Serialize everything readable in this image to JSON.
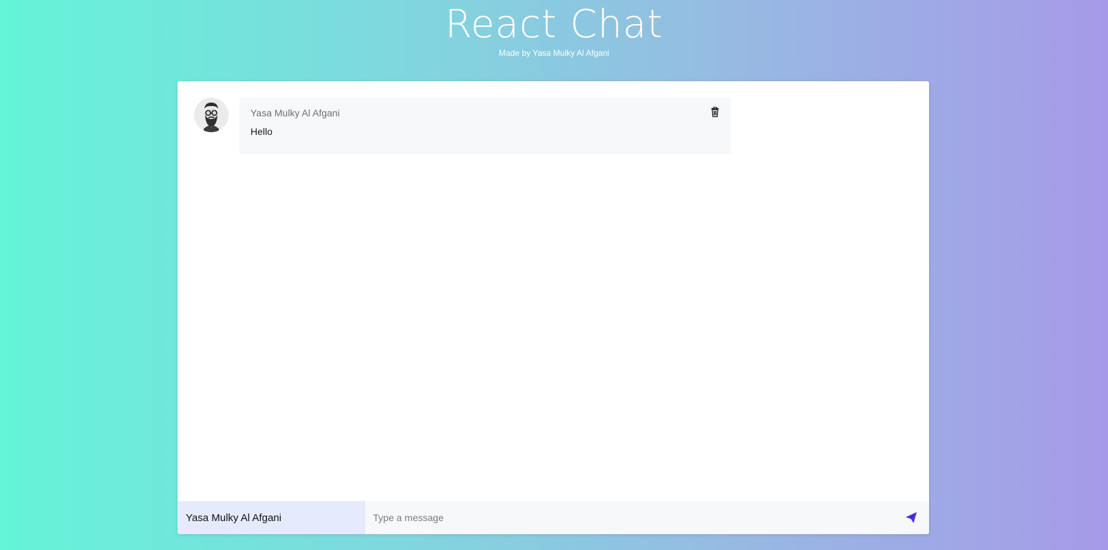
{
  "header": {
    "title": "React Chat",
    "subtitle": "Made by Yasa Mulky Al Afgani"
  },
  "messages": [
    {
      "sender": "Yasa Mulky Al Afgani",
      "text": "Hello",
      "avatar_icon": "bearded-man-avatar",
      "action_icon": "trash-icon"
    }
  ],
  "composer": {
    "username_value": "Yasa Mulky Al Afgani",
    "message_placeholder": "Type a message",
    "message_value": "",
    "send_icon": "paper-plane-icon"
  },
  "colors": {
    "accent": "#4f2fe0",
    "username_field_bg": "#e6eafd",
    "bubble_bg": "#f7f8fa"
  }
}
